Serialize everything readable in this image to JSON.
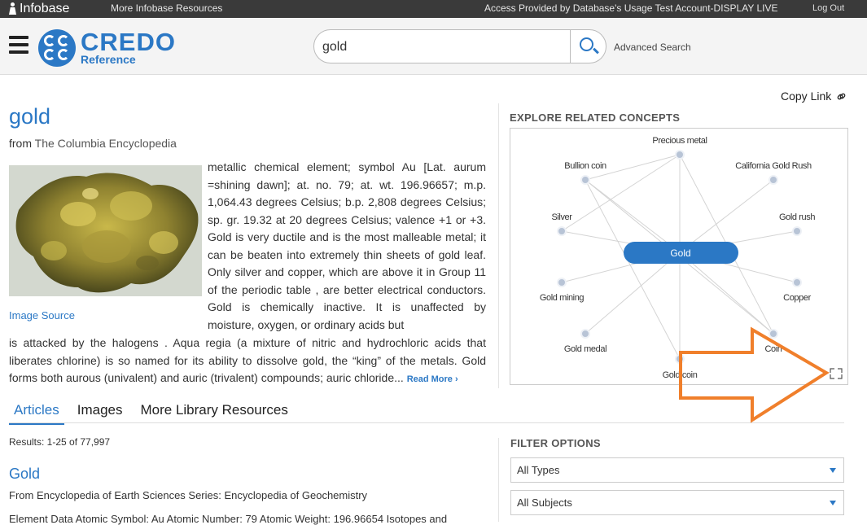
{
  "topbar": {
    "brand": "Infobase",
    "more": "More Infobase Resources",
    "access": "Access Provided by Database's Usage Test Account-DISPLAY LIVE",
    "logout": "Log Out"
  },
  "header": {
    "logo_main": "CREDO",
    "logo_sub": "Reference",
    "search_value": "gold",
    "advanced": "Advanced Search"
  },
  "article": {
    "title": "gold",
    "from_label": "from",
    "source": "The Columbia Encyclopedia",
    "image_source": "Image Source",
    "text_part1": "metallic chemical element; symbol Au [Lat. aurum =shining dawn]; at. no. 79; at. wt. 196.96657; m.p. 1,064.43 degrees Celsius; b.p. 2,808 degrees Celsius; sp. gr. 19.32 at 20 degrees Celsius; valence +1 or +3. Gold is very ductile and is the most malleable metal; it can be beaten into extremely thin sheets of gold leaf. Only silver and copper, which are above it in Group 11 of the periodic table , are better electrical conductors. Gold is chemically inactive. It is unaffected by moisture, oxygen, or ordinary acids but",
    "text_part2": "is attacked by the halogens . Aqua regia (a mixture of nitric and hydrochloric acids that liberates chlorine) is so named for its ability to dissolve gold, the “king” of the metals. Gold forms both aurous (univalent) and auric (trivalent) compounds; auric chloride...",
    "read_more": "Read More"
  },
  "tabs": [
    "Articles",
    "Images",
    "More Library Resources"
  ],
  "results": {
    "count_text": "Results:  1-25 of 77,997",
    "first_title": "Gold",
    "first_from_label": "From",
    "first_from": "Encyclopedia of Earth Sciences Series: Encyclopedia of Geochemistry",
    "first_snippet": "Element Data Atomic Symbol: Au Atomic Number: 79 Atomic Weight: 196.96654 Isotopes and"
  },
  "sidebar": {
    "copy_link": "Copy Link",
    "explore_heading": "EXPLORE RELATED CONCEPTS",
    "center_concept": "Gold",
    "concepts": [
      "Precious metal",
      "Bullion coin",
      "California Gold Rush",
      "Silver",
      "Gold rush",
      "Gold mining",
      "Copper",
      "Gold medal",
      "Coin",
      "Gold coin"
    ],
    "filter_heading": "FILTER OPTIONS",
    "types_select": "All Types",
    "subjects_select": "All Subjects"
  },
  "colors": {
    "accent": "#2b78c5",
    "topbar": "#3a3a3a",
    "annotation_arrow": "#f07f2b"
  }
}
